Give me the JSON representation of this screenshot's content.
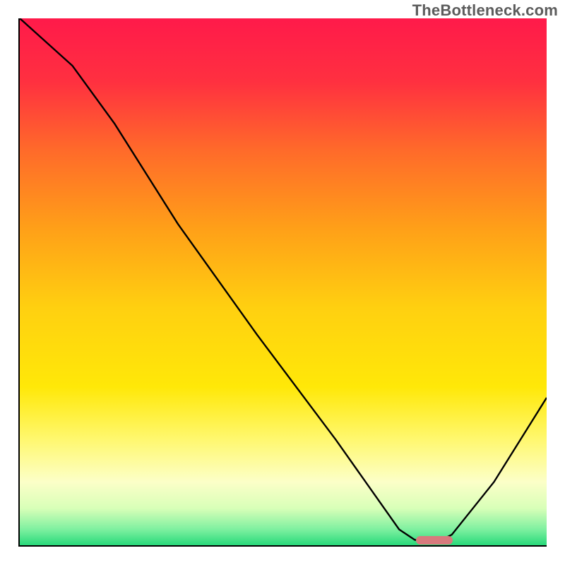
{
  "attribution": "TheBottleneck.com",
  "colors": {
    "curve": "#000000",
    "marker": "#d87a7d"
  },
  "gradient_stops": [
    {
      "offset": 0,
      "color": "#ff1a4a"
    },
    {
      "offset": 12,
      "color": "#ff3040"
    },
    {
      "offset": 25,
      "color": "#ff6a2a"
    },
    {
      "offset": 40,
      "color": "#ffa018"
    },
    {
      "offset": 55,
      "color": "#ffd010"
    },
    {
      "offset": 70,
      "color": "#ffe808"
    },
    {
      "offset": 80,
      "color": "#fff870"
    },
    {
      "offset": 88,
      "color": "#fcffc8"
    },
    {
      "offset": 93,
      "color": "#d8ffb8"
    },
    {
      "offset": 97,
      "color": "#7ef0a0"
    },
    {
      "offset": 100,
      "color": "#28d97a"
    }
  ],
  "chart_data": {
    "type": "line",
    "title": "",
    "xlabel": "",
    "ylabel": "",
    "xlim": [
      0,
      100
    ],
    "ylim": [
      0,
      100
    ],
    "series": [
      {
        "name": "bottleneck-curve",
        "x": [
          0,
          10,
          18,
          30,
          45,
          60,
          72,
          75,
          80,
          82,
          90,
          100
        ],
        "values": [
          100,
          91,
          80,
          61,
          40,
          20,
          3,
          1,
          1,
          2,
          12,
          28
        ]
      }
    ],
    "marker": {
      "x_start": 75,
      "x_end": 82,
      "y": 1.2
    }
  }
}
